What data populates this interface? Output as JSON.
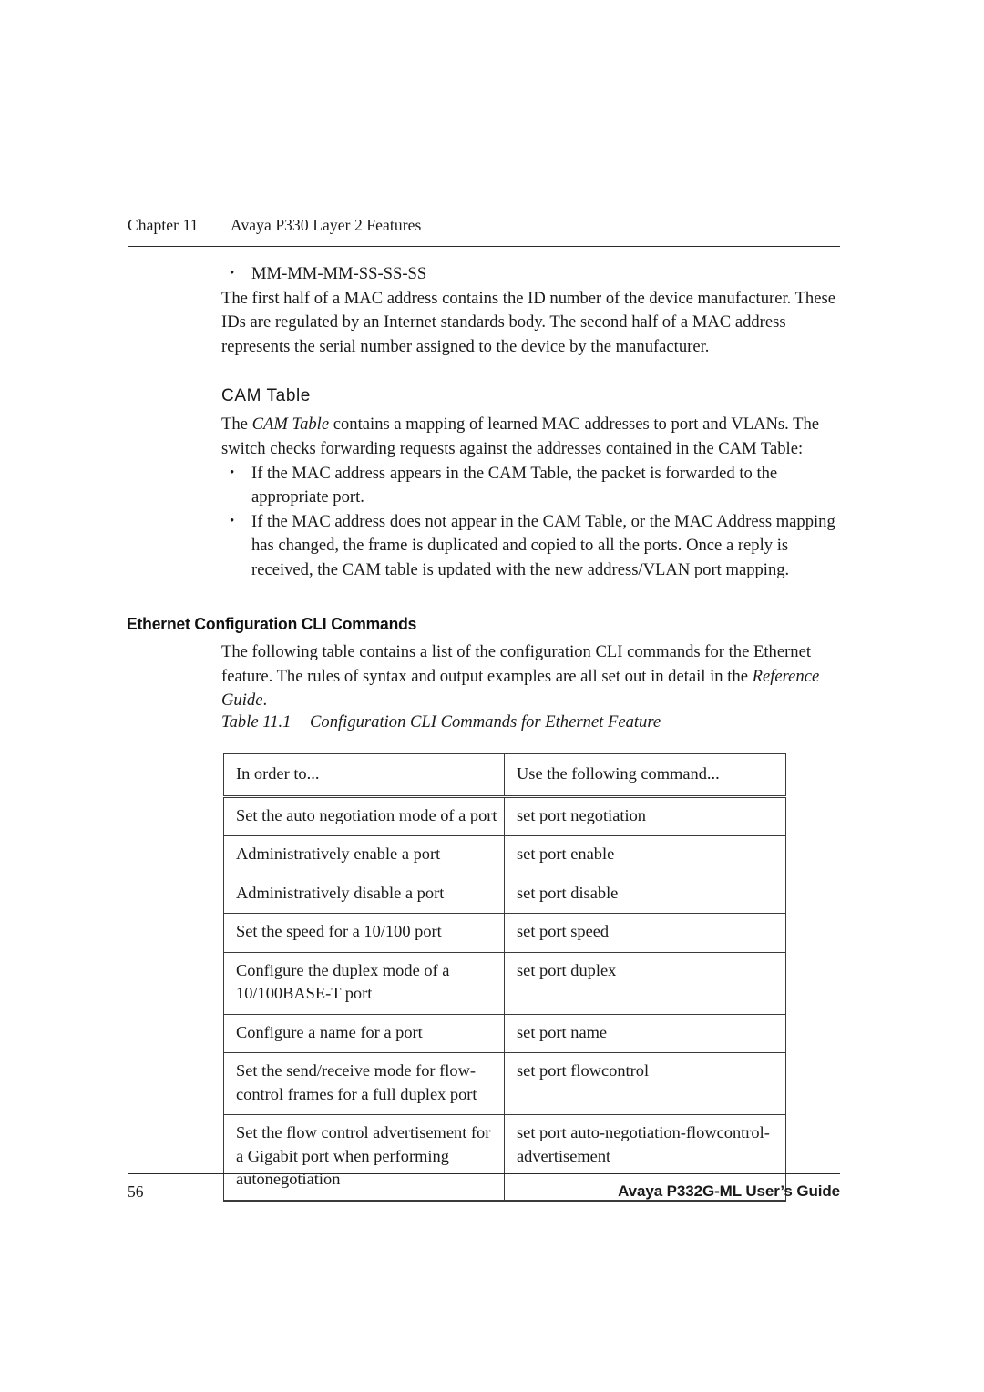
{
  "header": {
    "chapter_label": "Chapter 11",
    "chapter_title": "Avaya P330 Layer 2 Features"
  },
  "content": {
    "mac_bullet": "MM-MM-MM-SS-SS-SS",
    "mac_paragraph": "The first half of a MAC address contains the ID number of the device manufacturer. These IDs are regulated by an Internet standards body. The second half of a MAC address represents the serial number assigned to the device by the manufacturer.",
    "cam_heading": "CAM Table",
    "cam_paragraph_pre": "The ",
    "cam_paragraph_italic": "CAM Table",
    "cam_paragraph_post": " contains a mapping of learned MAC addresses to port and VLANs. The switch checks forwarding requests against the addresses contained in the CAM Table:",
    "cam_bullets": [
      "If the MAC address appears in the CAM Table, the packet is forwarded to the appropriate port.",
      "If the MAC address does not appear in the CAM Table, or the MAC Address mapping has changed, the frame is duplicated and copied to all the ports. Once a reply is received, the CAM table is updated with the new address/VLAN port mapping."
    ],
    "bullet_glyph": "•",
    "section_heading": "Ethernet Configuration CLI Commands",
    "intro_paragraph_pre": "The following table contains a list of the configuration CLI commands for the Ethernet feature. The rules of syntax and output examples are all set out in detail in the ",
    "intro_paragraph_italic": "Reference Guide",
    "intro_paragraph_post": "."
  },
  "table": {
    "caption_label": "Table 11.1",
    "caption_text": "Configuration CLI Commands for Ethernet Feature",
    "columns": [
      "In order to...",
      "Use the following command..."
    ],
    "rows": [
      [
        "Set the auto negotiation mode of a port",
        "set port negotiation"
      ],
      [
        "Administratively enable a port",
        "set port enable"
      ],
      [
        "Administratively disable a port",
        "set port disable"
      ],
      [
        "Set the speed for a 10/100 port",
        "set port speed"
      ],
      [
        "Configure the duplex mode of a 10/100BASE-T port",
        "set port duplex"
      ],
      [
        "Configure a name for a port",
        "set port name"
      ],
      [
        "Set the send/receive mode for flow-control frames for a full duplex port",
        "set port flowcontrol"
      ],
      [
        "Set the flow control advertisement for a Gigabit port when performing autonegotiation",
        "set port auto-negotiation-flowcontrol-advertisement"
      ]
    ]
  },
  "footer": {
    "page_number": "56",
    "guide_title": "Avaya P332G-ML User’s Guide"
  }
}
